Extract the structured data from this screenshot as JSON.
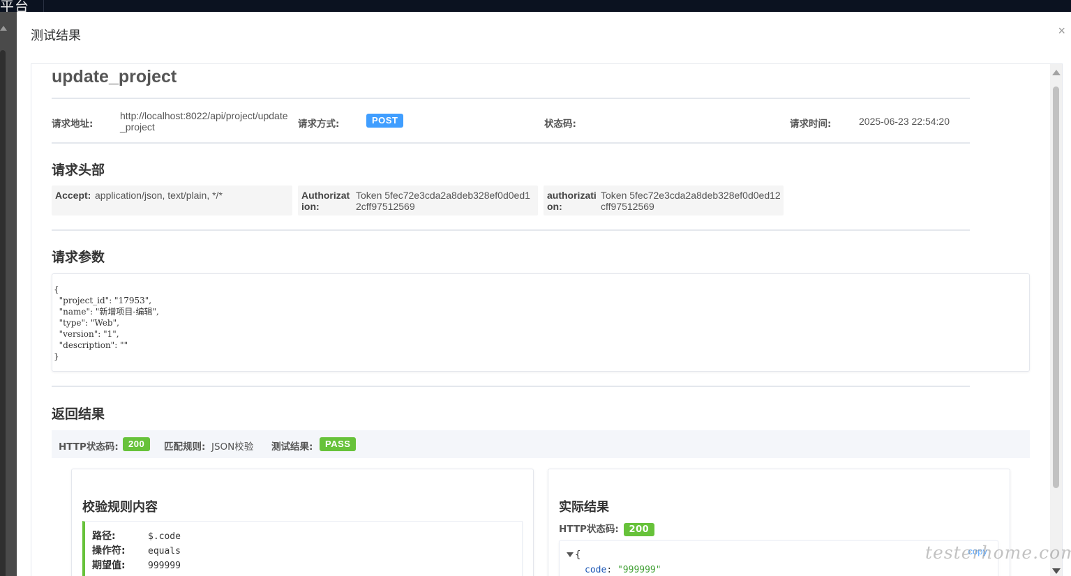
{
  "app": {
    "topbar_fragment": "平台"
  },
  "dialog": {
    "title": "测试结果",
    "close_glyph": "×"
  },
  "api": {
    "name": "update_project"
  },
  "request_info": {
    "url_label": "请求地址:",
    "url_line1": "http://localhost:8022/api/project/update",
    "url_line2": "_project",
    "method_label": "请求方式:",
    "method": "POST",
    "status_label": "状态码:",
    "status": "",
    "time_label": "请求时间:",
    "time": "2025-06-23 22:54:20"
  },
  "headers_section": {
    "title": "请求头部",
    "items": [
      {
        "key": "Accept:",
        "value_line1": "application/json, text/plain, */*",
        "value_line2": ""
      },
      {
        "key_line1": "Authorizat",
        "key_line2": "ion:",
        "value_line1": "Token 5fec72e3cda2a8deb328ef0d0ed1",
        "value_line2": "2cff97512569"
      },
      {
        "key_line1": "authorizati",
        "key_line2": "on:",
        "value_line1": "Token 5fec72e3cda2a8deb328ef0d0ed12",
        "value_line2": "cff97512569"
      }
    ]
  },
  "params_section": {
    "title": "请求参数",
    "json_text": "{\n  \"project_id\": \"17953\",\n  \"name\": \"新增项目-编辑\",\n  \"type\": \"Web\",\n  \"version\": \"1\",\n  \"description\": \"\"\n}"
  },
  "result_section": {
    "title": "返回结果",
    "http_label": "HTTP状态码:",
    "http_code": "200",
    "rule_label": "匹配规则:",
    "rule_value": "JSON校验",
    "test_label": "测试结果:",
    "test_value": "PASS"
  },
  "rule_card": {
    "title": "校验规则内容",
    "rows": [
      {
        "key": "路径:",
        "value": "$.code"
      },
      {
        "key": "操作符:",
        "value": "equals"
      },
      {
        "key": "期望值:",
        "value": "999999"
      }
    ]
  },
  "actual_card": {
    "title": "实际结果",
    "http_label": "HTTP状态码:",
    "http_code": "200",
    "copy_label": "copy",
    "json_open": "{",
    "first_key": "code",
    "first_sep": ":",
    "first_value": "\"999999\""
  },
  "watermark": "testerhome.com",
  "colors": {
    "method_tag": "#409eff",
    "pass_tag": "#67c23a",
    "rule_accent": "#67c23a",
    "copy_link": "#5aa8ff"
  }
}
